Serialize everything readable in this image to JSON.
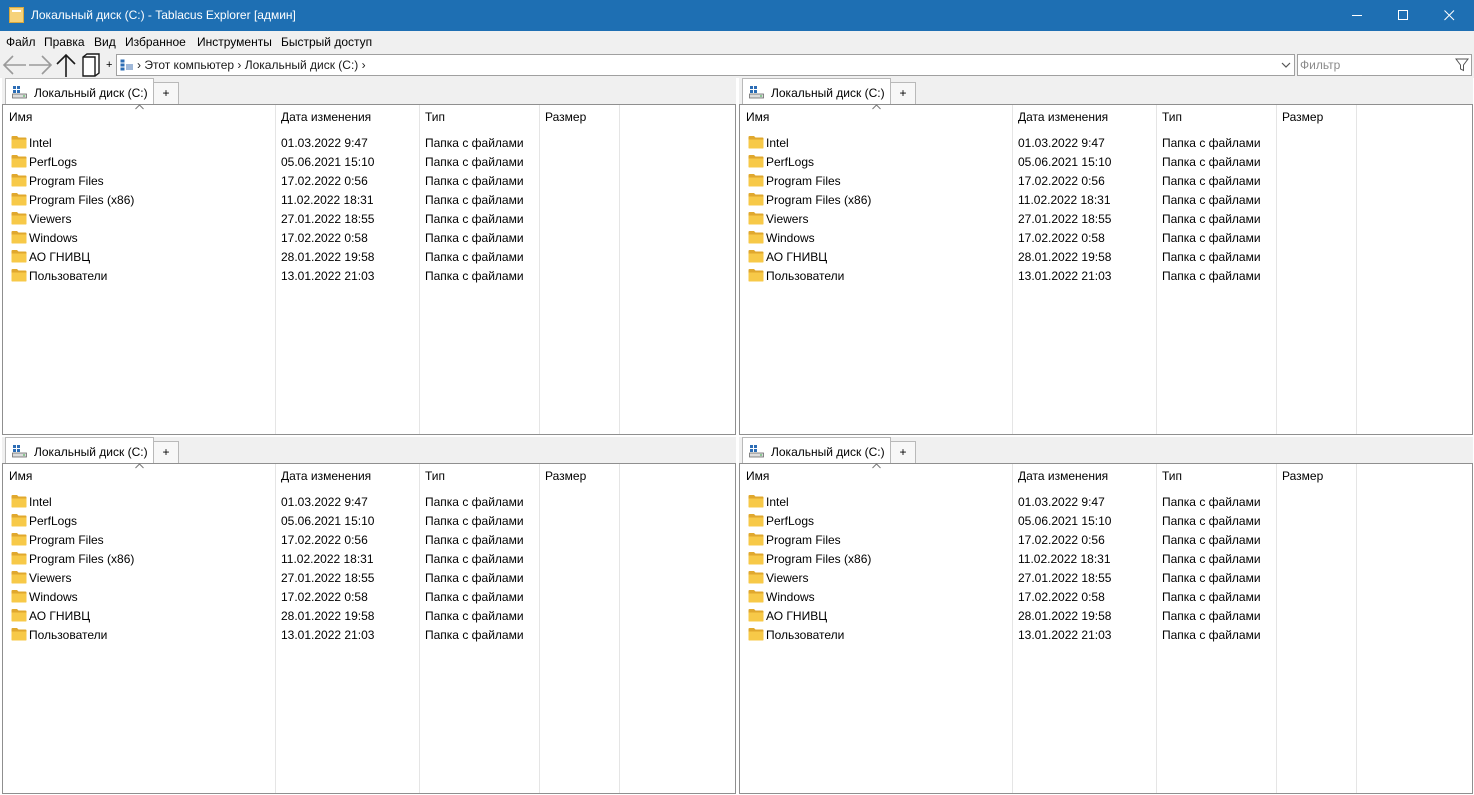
{
  "window": {
    "title": "Локальный диск (C:) - Tablacus Explorer [админ]",
    "title_bar_color": "#1e6fb3"
  },
  "menu": [
    "Файл",
    "Правка",
    "Вид",
    "Избранное",
    "Инструменты",
    "Быстрый доступ"
  ],
  "toolbar": {
    "buttons": [
      "back-arrow-icon",
      "forward-arrow-icon",
      "up-arrow-icon",
      "new-tab-icon"
    ],
    "add_label": "+"
  },
  "address": {
    "path": "› Этот компьютер › Локальный диск (C:) ›"
  },
  "filter": {
    "placeholder": "Фильтр"
  },
  "panes": [
    {
      "tab_label": "Локальный диск (C:)",
      "add_tab_label": "+",
      "columns": [
        "Имя",
        "Дата изменения",
        "Тип",
        "Размер"
      ],
      "rows": [
        {
          "name": "Intel",
          "date": "01.03.2022 9:47",
          "type": "Папка с файлами"
        },
        {
          "name": "PerfLogs",
          "date": "05.06.2021 15:10",
          "type": "Папка с файлами"
        },
        {
          "name": "Program Files",
          "date": "17.02.2022 0:56",
          "type": "Папка с файлами"
        },
        {
          "name": "Program Files (x86)",
          "date": "11.02.2022 18:31",
          "type": "Папка с файлами"
        },
        {
          "name": "Viewers",
          "date": "27.01.2022 18:55",
          "type": "Папка с файлами"
        },
        {
          "name": "Windows",
          "date": "17.02.2022 0:58",
          "type": "Папка с файлами"
        },
        {
          "name": "АО ГНИВЦ",
          "date": "28.01.2022 19:58",
          "type": "Папка с файлами"
        },
        {
          "name": "Пользователи",
          "date": "13.01.2022 21:03",
          "type": "Папка с файлами"
        }
      ]
    },
    {
      "tab_label": "Локальный диск (C:)",
      "add_tab_label": "+",
      "columns": [
        "Имя",
        "Дата изменения",
        "Тип",
        "Размер"
      ],
      "rows": [
        {
          "name": "Intel",
          "date": "01.03.2022 9:47",
          "type": "Папка с файлами"
        },
        {
          "name": "PerfLogs",
          "date": "05.06.2021 15:10",
          "type": "Папка с файлами"
        },
        {
          "name": "Program Files",
          "date": "17.02.2022 0:56",
          "type": "Папка с файлами"
        },
        {
          "name": "Program Files (x86)",
          "date": "11.02.2022 18:31",
          "type": "Папка с файлами"
        },
        {
          "name": "Viewers",
          "date": "27.01.2022 18:55",
          "type": "Папка с файлами"
        },
        {
          "name": "Windows",
          "date": "17.02.2022 0:58",
          "type": "Папка с файлами"
        },
        {
          "name": "АО ГНИВЦ",
          "date": "28.01.2022 19:58",
          "type": "Папка с файлами"
        },
        {
          "name": "Пользователи",
          "date": "13.01.2022 21:03",
          "type": "Папка с файлами"
        }
      ]
    },
    {
      "tab_label": "Локальный диск (C:)",
      "add_tab_label": "+",
      "columns": [
        "Имя",
        "Дата изменения",
        "Тип",
        "Размер"
      ],
      "rows": [
        {
          "name": "Intel",
          "date": "01.03.2022 9:47",
          "type": "Папка с файлами"
        },
        {
          "name": "PerfLogs",
          "date": "05.06.2021 15:10",
          "type": "Папка с файлами"
        },
        {
          "name": "Program Files",
          "date": "17.02.2022 0:56",
          "type": "Папка с файлами"
        },
        {
          "name": "Program Files (x86)",
          "date": "11.02.2022 18:31",
          "type": "Папка с файлами"
        },
        {
          "name": "Viewers",
          "date": "27.01.2022 18:55",
          "type": "Папка с файлами"
        },
        {
          "name": "Windows",
          "date": "17.02.2022 0:58",
          "type": "Папка с файлами"
        },
        {
          "name": "АО ГНИВЦ",
          "date": "28.01.2022 19:58",
          "type": "Папка с файлами"
        },
        {
          "name": "Пользователи",
          "date": "13.01.2022 21:03",
          "type": "Папка с файлами"
        }
      ]
    },
    {
      "tab_label": "Локальный диск (C:)",
      "add_tab_label": "+",
      "columns": [
        "Имя",
        "Дата изменения",
        "Тип",
        "Размер"
      ],
      "rows": [
        {
          "name": "Intel",
          "date": "01.03.2022 9:47",
          "type": "Папка с файлами"
        },
        {
          "name": "PerfLogs",
          "date": "05.06.2021 15:10",
          "type": "Папка с файлами"
        },
        {
          "name": "Program Files",
          "date": "17.02.2022 0:56",
          "type": "Папка с файлами"
        },
        {
          "name": "Program Files (x86)",
          "date": "11.02.2022 18:31",
          "type": "Папка с файлами"
        },
        {
          "name": "Viewers",
          "date": "27.01.2022 18:55",
          "type": "Папка с файлами"
        },
        {
          "name": "Windows",
          "date": "17.02.2022 0:58",
          "type": "Папка с файлами"
        },
        {
          "name": "АО ГНИВЦ",
          "date": "28.01.2022 19:58",
          "type": "Папка с файлами"
        },
        {
          "name": "Пользователи",
          "date": "13.01.2022 21:03",
          "type": "Папка с файлами"
        }
      ]
    }
  ],
  "colors": {
    "folder": "#f7c948",
    "folder_dark": "#e0a82e"
  }
}
